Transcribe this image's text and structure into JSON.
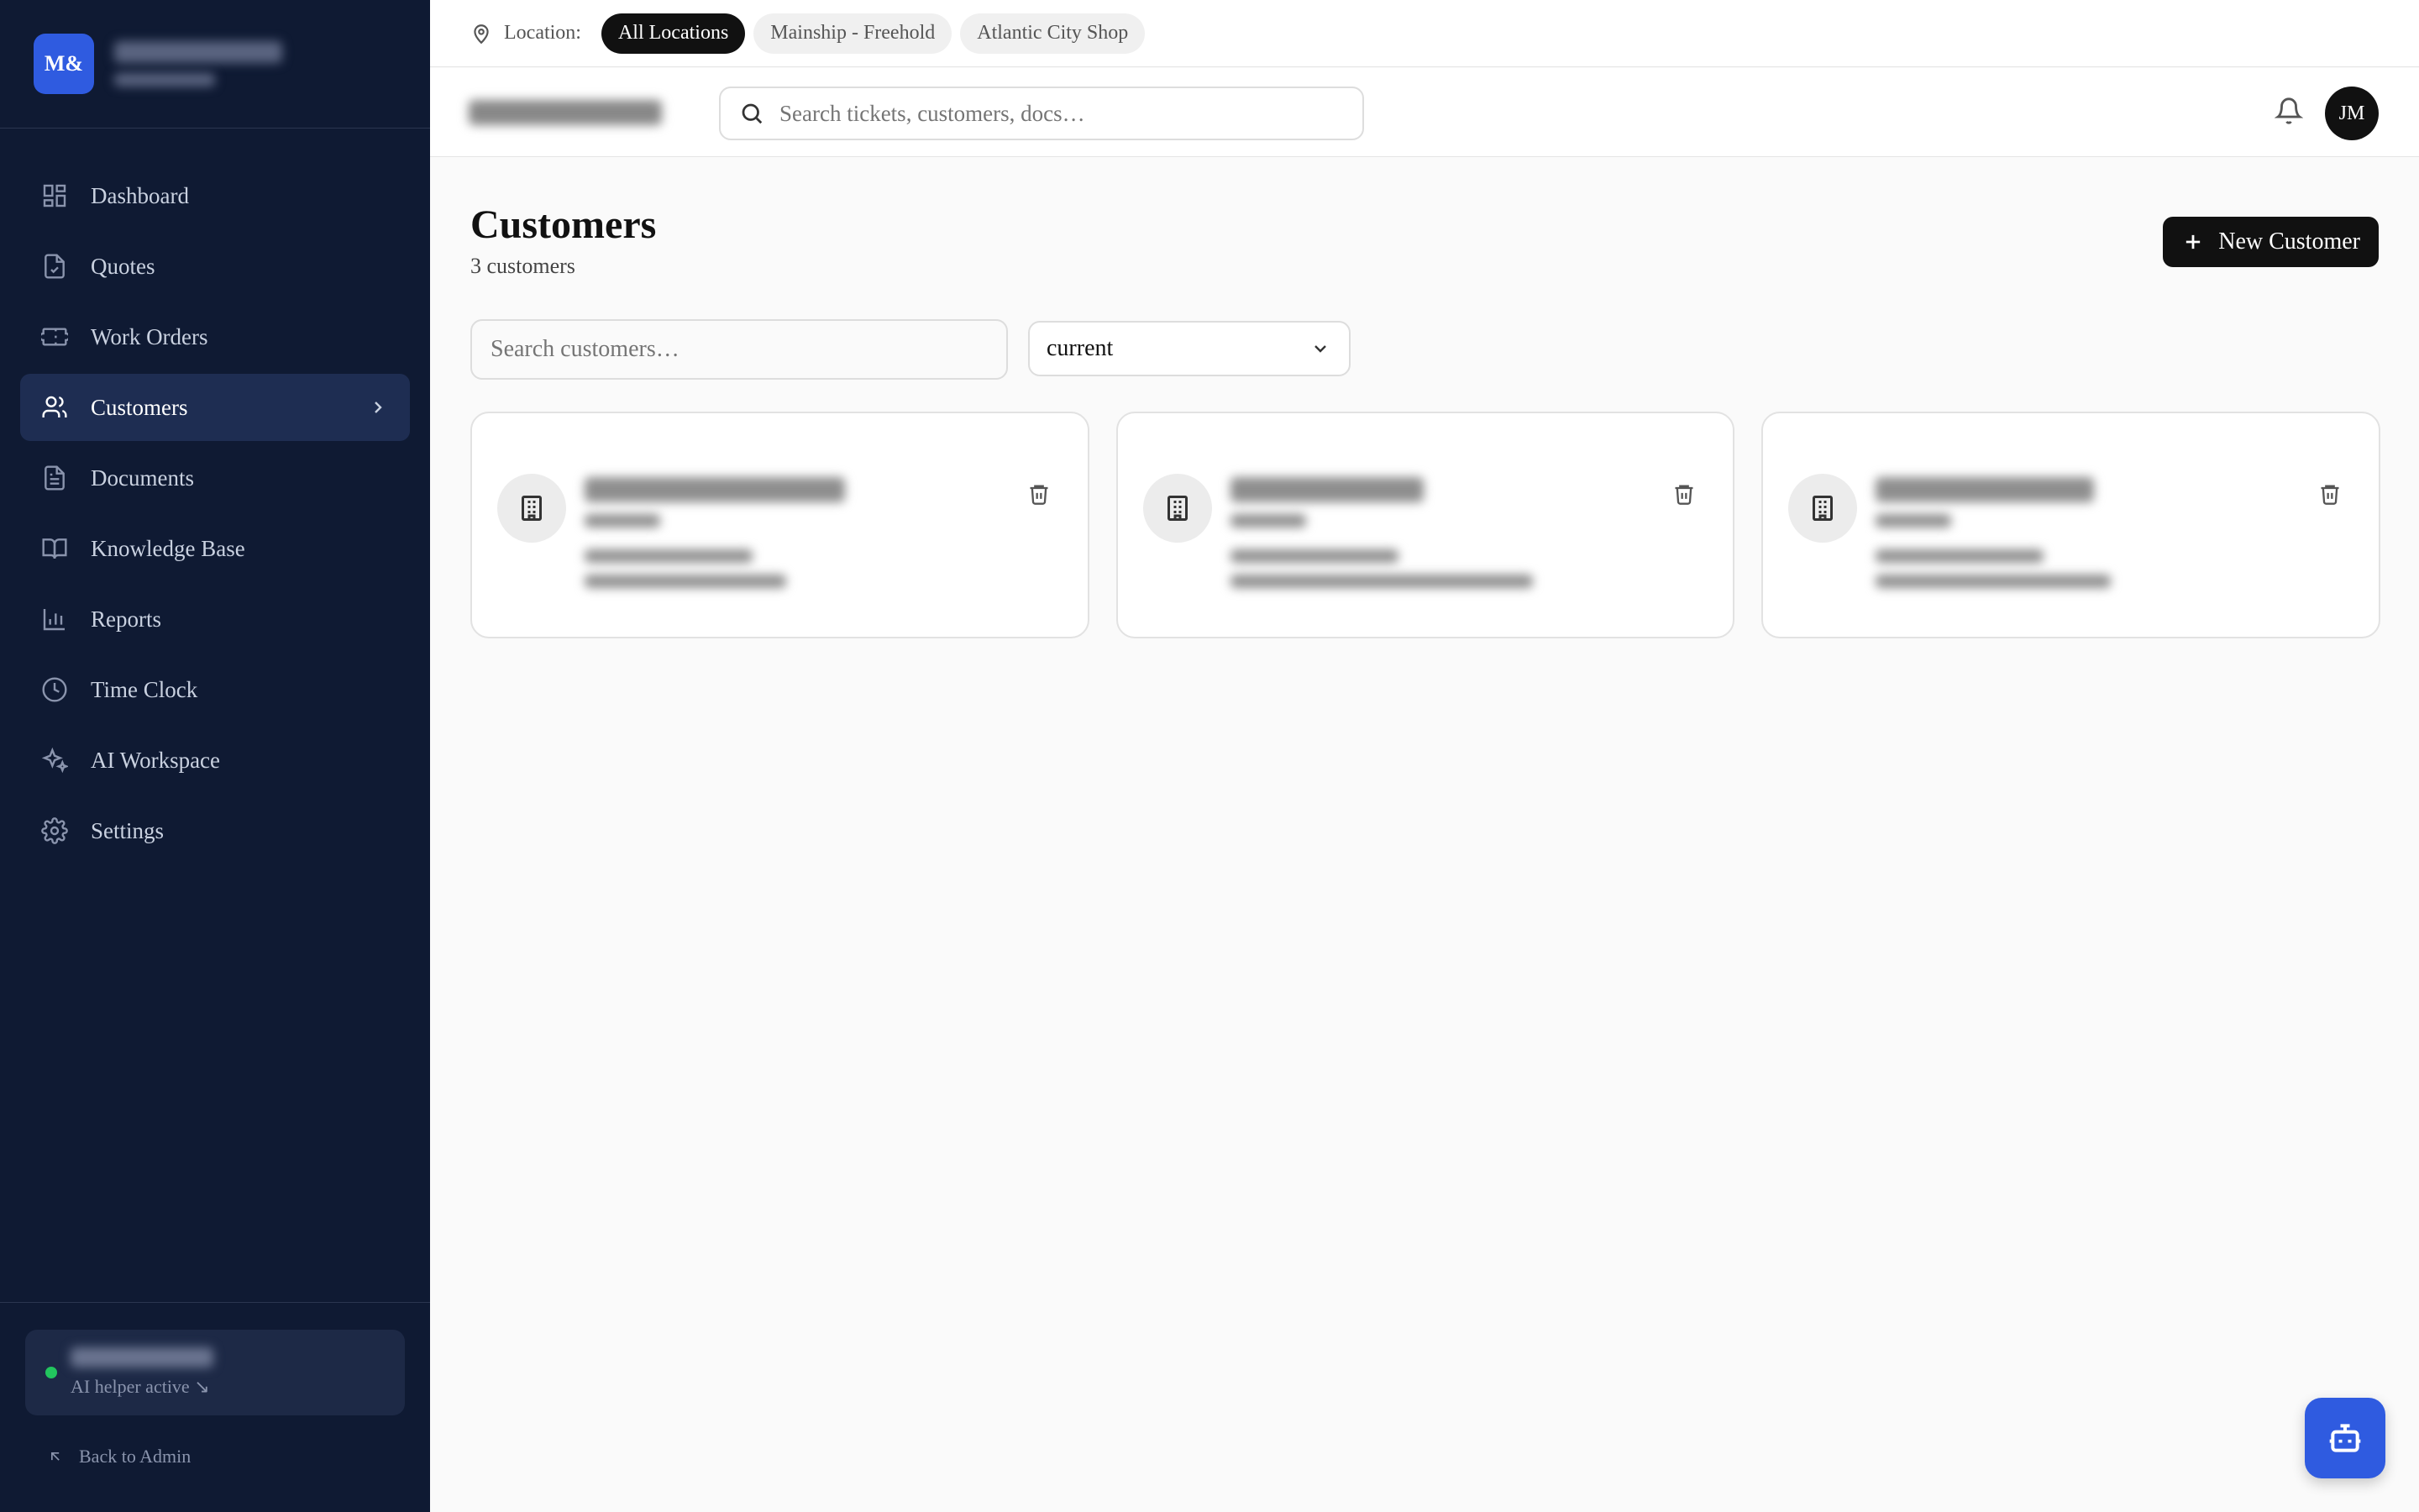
{
  "brand": {
    "logo_text": "M&"
  },
  "sidebar": {
    "items": [
      {
        "label": "Dashboard",
        "icon": "dashboard-icon"
      },
      {
        "label": "Quotes",
        "icon": "quote-file-icon"
      },
      {
        "label": "Work Orders",
        "icon": "ticket-icon"
      },
      {
        "label": "Customers",
        "icon": "users-icon",
        "active": true
      },
      {
        "label": "Documents",
        "icon": "document-icon"
      },
      {
        "label": "Knowledge Base",
        "icon": "book-icon"
      },
      {
        "label": "Reports",
        "icon": "bar-chart-icon"
      },
      {
        "label": "Time Clock",
        "icon": "clock-icon"
      },
      {
        "label": "AI Workspace",
        "icon": "sparkles-icon"
      },
      {
        "label": "Settings",
        "icon": "gear-icon"
      }
    ],
    "ai_helper": "AI helper active ↘",
    "back_admin": "Back to Admin"
  },
  "location": {
    "label": "Location:",
    "options": [
      "All Locations",
      "Mainship - Freehold",
      "Atlantic City Shop"
    ],
    "selected": "All Locations"
  },
  "header": {
    "search_placeholder": "Search tickets, customers, docs…",
    "avatar_initials": "JM"
  },
  "main": {
    "title": "Customers",
    "count": "3 customers",
    "new_button": "New Customer",
    "search_placeholder": "Search customers…",
    "filter_value": "current"
  },
  "colors": {
    "sidebar_bg": "#0f1a33",
    "accent": "#2f5be0",
    "status_active": "#22c55e"
  }
}
